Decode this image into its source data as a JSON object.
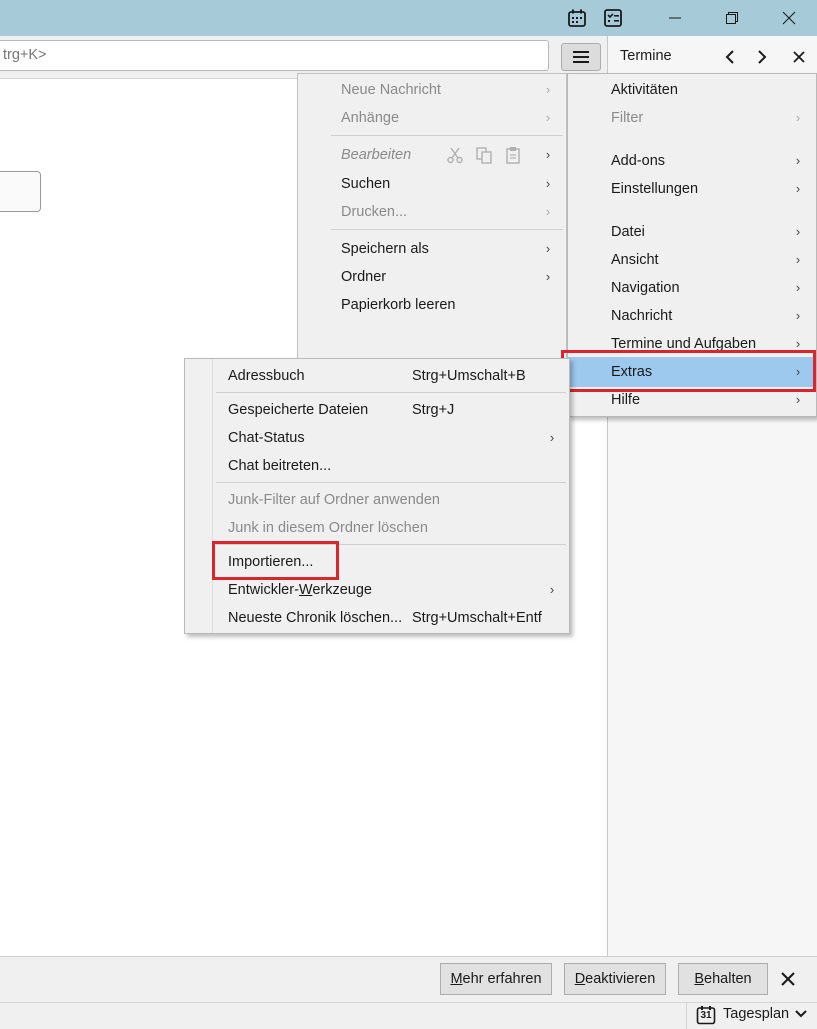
{
  "titlebar": {
    "calendar_icon": "calendar-icon",
    "tasks_icon": "tasks-icon",
    "minimize": "—",
    "restore": "❐",
    "close": "✕"
  },
  "search": {
    "placeholder_text": "trg+K>"
  },
  "right_panel": {
    "title": "Termine",
    "prev": "‹",
    "next": "›",
    "close": "✕"
  },
  "left_menu": {
    "items": [
      {
        "label": "Neue Nachricht",
        "disabled": true
      },
      {
        "label": "Anhänge",
        "disabled": true
      },
      {
        "label": "Bearbeiten",
        "disabled": true
      },
      {
        "label": "Suchen",
        "disabled": false
      },
      {
        "label": "Drucken...",
        "disabled": true
      },
      {
        "label": "Speichern als",
        "disabled": false
      },
      {
        "label": "Ordner",
        "disabled": false
      },
      {
        "label": "Papierkorb leeren",
        "disabled": false
      }
    ]
  },
  "app_menu": {
    "items": [
      {
        "label": "Aktivitäten"
      },
      {
        "label": "Filter"
      },
      {
        "label": "Add-ons"
      },
      {
        "label": "Einstellungen"
      },
      {
        "label": "Datei"
      },
      {
        "label": "Ansicht"
      },
      {
        "label": "Navigation"
      },
      {
        "label": "Nachricht"
      },
      {
        "label": "Termine und Aufgaben"
      },
      {
        "label": "Extras"
      },
      {
        "label": "Hilfe"
      }
    ]
  },
  "extras_menu": {
    "items": [
      {
        "label": "Adressbuch",
        "shortcut": "Strg+Umschalt+B"
      },
      {
        "label": "Gespeicherte Dateien",
        "shortcut": "Strg+J"
      },
      {
        "label": "Chat-Status",
        "shortcut": ""
      },
      {
        "label": "Chat beitreten...",
        "shortcut": ""
      },
      {
        "label": "Junk-Filter auf Ordner anwenden",
        "shortcut": ""
      },
      {
        "label": "Junk in diesem Ordner löschen",
        "shortcut": ""
      },
      {
        "label": "Importieren...",
        "shortcut": ""
      },
      {
        "label_pre": "Entwickler-",
        "label_u": "W",
        "label_post": "erkzeuge",
        "shortcut": ""
      },
      {
        "label": "Neueste Chronik löschen...",
        "shortcut": "Strg+Umschalt+Entf"
      }
    ]
  },
  "notification": {
    "more_u": "M",
    "more_rest": "ehr erfahren",
    "disable_u": "D",
    "disable_rest": "eaktivieren",
    "keep_u": "B",
    "keep_rest": "ehalten",
    "close": "✕"
  },
  "statusbar": {
    "calendar_day": "31",
    "label": "Tagesplan",
    "chevron": "⌄"
  },
  "colors": {
    "titlebar": "#a7cad9",
    "highlight": "#9dc9ef",
    "annotation": "#d9262e"
  }
}
